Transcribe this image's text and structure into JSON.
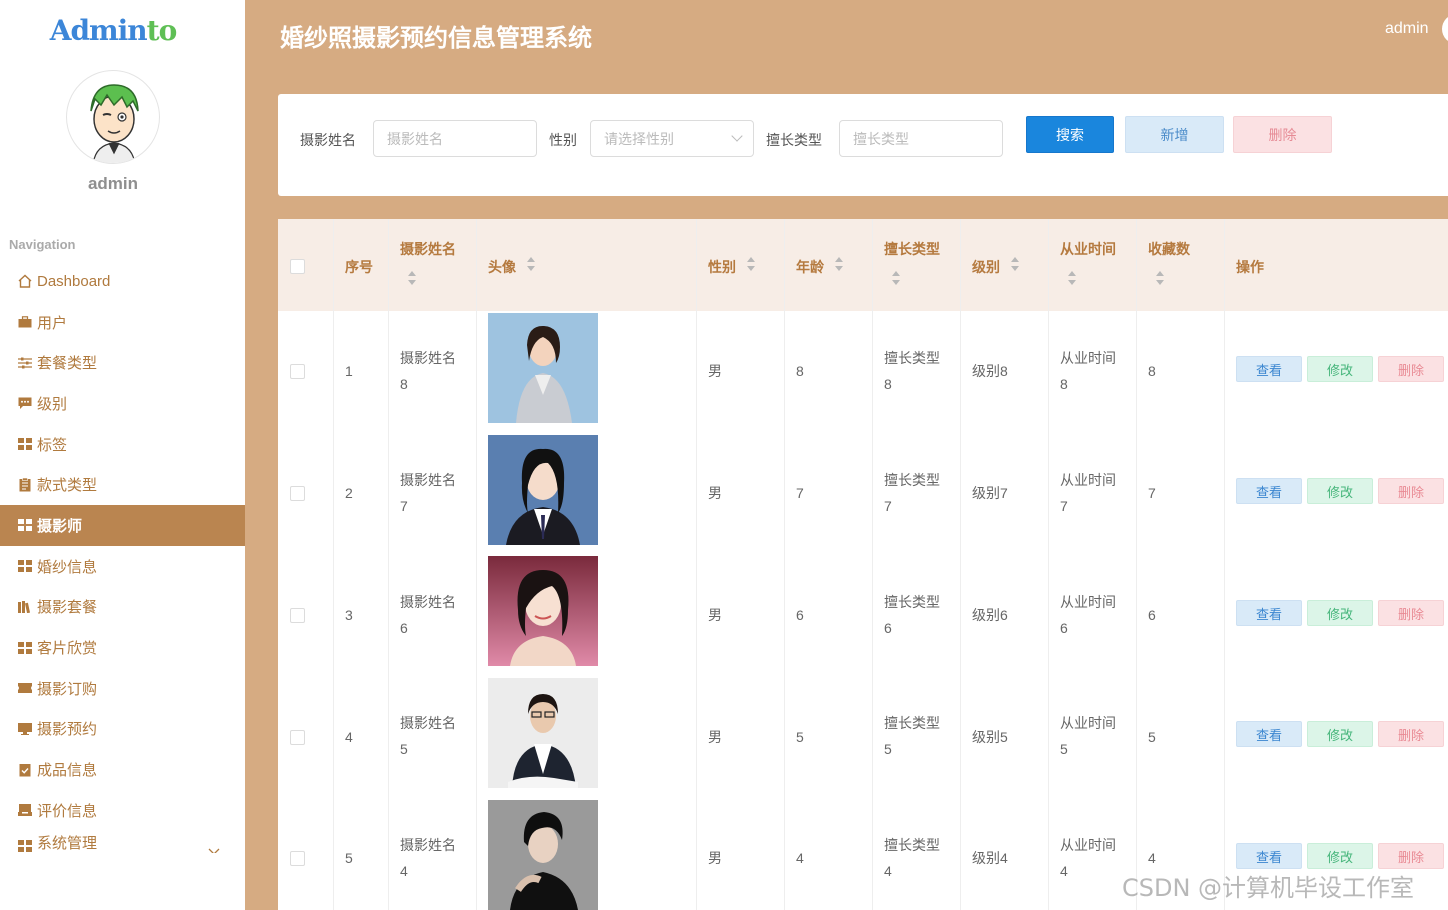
{
  "sidebar": {
    "logo_part1": "Admin",
    "logo_part2": "to",
    "username": "admin",
    "nav_title": "Navigation",
    "items": [
      {
        "label": "Dashboard",
        "icon": "home-icon"
      },
      {
        "label": "用户",
        "icon": "briefcase-icon"
      },
      {
        "label": "套餐类型",
        "icon": "sliders-icon"
      },
      {
        "label": "级别",
        "icon": "comment-icon"
      },
      {
        "label": "标签",
        "icon": "grid-icon"
      },
      {
        "label": "款式类型",
        "icon": "document-icon"
      },
      {
        "label": "摄影师",
        "icon": "grid-icon",
        "active": true
      },
      {
        "label": "婚纱信息",
        "icon": "grid-icon"
      },
      {
        "label": "摄影套餐",
        "icon": "books-icon"
      },
      {
        "label": "客片欣赏",
        "icon": "grid-icon"
      },
      {
        "label": "摄影订购",
        "icon": "ticket-icon"
      },
      {
        "label": "摄影预约",
        "icon": "monitor-icon"
      },
      {
        "label": "成品信息",
        "icon": "clipboard-check-icon"
      },
      {
        "label": "评价信息",
        "icon": "inbox-icon"
      },
      {
        "label": "系统管理",
        "icon": "grid-icon"
      }
    ]
  },
  "header": {
    "title": "婚纱照摄影预约信息管理系统",
    "user": "admin"
  },
  "search": {
    "name_label": "摄影姓名",
    "name_placeholder": "摄影姓名",
    "gender_label": "性别",
    "gender_placeholder": "请选择性别",
    "type_label": "擅长类型",
    "type_placeholder": "擅长类型",
    "search_btn": "搜索",
    "add_btn": "新增",
    "delete_btn": "删除"
  },
  "table": {
    "columns": {
      "index": "序号",
      "name": "摄影姓名",
      "avatar": "头像",
      "gender": "性别",
      "age": "年龄",
      "type": "擅长类型",
      "level": "级别",
      "years": "从业时间",
      "favorites": "收藏数",
      "actions": "操作"
    },
    "action_labels": {
      "view": "查看",
      "edit": "修改",
      "delete": "删除"
    },
    "rows": [
      {
        "index": "1",
        "name_a": "摄影姓名",
        "name_b": "8",
        "gender": "男",
        "age": "8",
        "type_a": "擅长类型",
        "type_b": "8",
        "level": "级别8",
        "years_a": "从业时间",
        "years_b": "8",
        "favorites": "8"
      },
      {
        "index": "2",
        "name_a": "摄影姓名",
        "name_b": "7",
        "gender": "男",
        "age": "7",
        "type_a": "擅长类型",
        "type_b": "7",
        "level": "级别7",
        "years_a": "从业时间",
        "years_b": "7",
        "favorites": "7"
      },
      {
        "index": "3",
        "name_a": "摄影姓名",
        "name_b": "6",
        "gender": "男",
        "age": "6",
        "type_a": "擅长类型",
        "type_b": "6",
        "level": "级别6",
        "years_a": "从业时间",
        "years_b": "6",
        "favorites": "6"
      },
      {
        "index": "4",
        "name_a": "摄影姓名",
        "name_b": "5",
        "gender": "男",
        "age": "5",
        "type_a": "擅长类型",
        "type_b": "5",
        "level": "级别5",
        "years_a": "从业时间",
        "years_b": "5",
        "favorites": "5"
      },
      {
        "index": "5",
        "name_a": "摄影姓名",
        "name_b": "4",
        "gender": "男",
        "age": "4",
        "type_a": "擅长类型",
        "type_b": "4",
        "level": "级别4",
        "years_a": "从业时间",
        "years_b": "4",
        "favorites": "4"
      }
    ]
  },
  "watermark": "CSDN @计算机毕设工作室",
  "colors": {
    "header_bg": "#d6ab82",
    "active_menu": "#ba8550",
    "accent_text": "#b57a3f",
    "search_btn": "#1a86dd"
  }
}
